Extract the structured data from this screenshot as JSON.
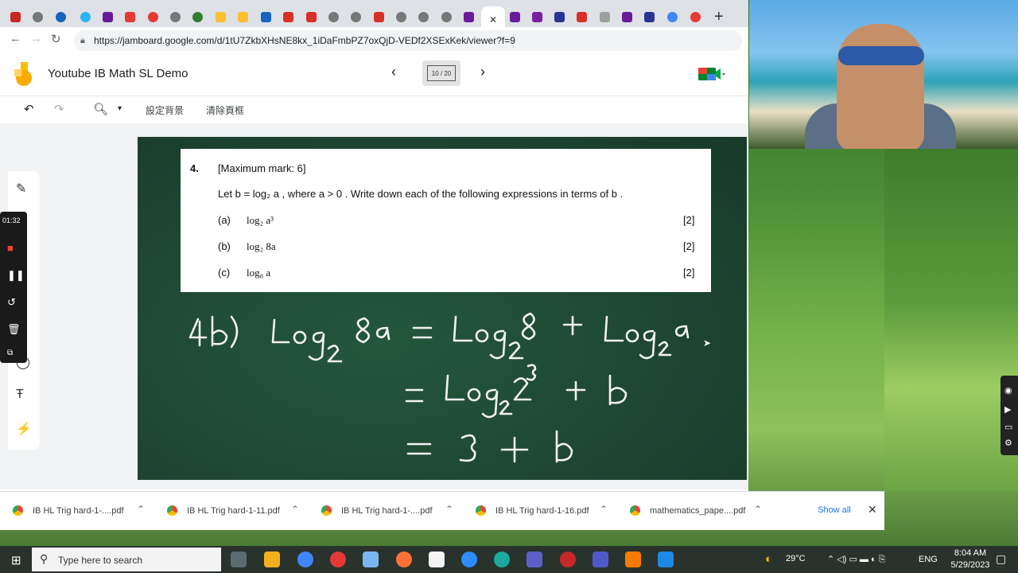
{
  "browser": {
    "url": "https://jamboard.google.com/d/1tU7ZkbXHsNE8kx_1iDaFmbPZ7oxQjD-VEDf2XSExKek/viewer?f=9",
    "new_tab": "+",
    "close_tab": "✕"
  },
  "jamboard": {
    "title": "Youtube IB Math SL Demo",
    "frame_counter": "10 / 20",
    "set_background": "設定背景",
    "clear_frame": "清除頁框"
  },
  "question": {
    "number": "4.",
    "max_mark": "[Maximum mark:  6]",
    "stem": "Let b = log₂ a , where  a > 0 .  Write down each of the following expressions in terms of  b .",
    "parts": [
      {
        "label": "(a)",
        "expr": "log₂ a³",
        "mark": "[2]"
      },
      {
        "label": "(b)",
        "expr": "log₂ 8a",
        "mark": "[2]"
      },
      {
        "label": "(c)",
        "expr": "log₈ a",
        "mark": "[2]"
      }
    ]
  },
  "recorder": {
    "time": "01:32"
  },
  "downloads": {
    "items": [
      {
        "name": "IB HL Trig hard-1-....pdf"
      },
      {
        "name": "IB HL Trig hard-1-11.pdf"
      },
      {
        "name": "IB HL Trig hard-1-....pdf"
      },
      {
        "name": "IB HL Trig hard-1-16.pdf"
      },
      {
        "name": "mathematics_pape....pdf"
      }
    ],
    "show_all": "Show all"
  },
  "taskbar": {
    "search_placeholder": "Type here to search",
    "weather": "29°C",
    "language": "ENG",
    "time": "8:04 AM",
    "date": "5/29/2023"
  }
}
